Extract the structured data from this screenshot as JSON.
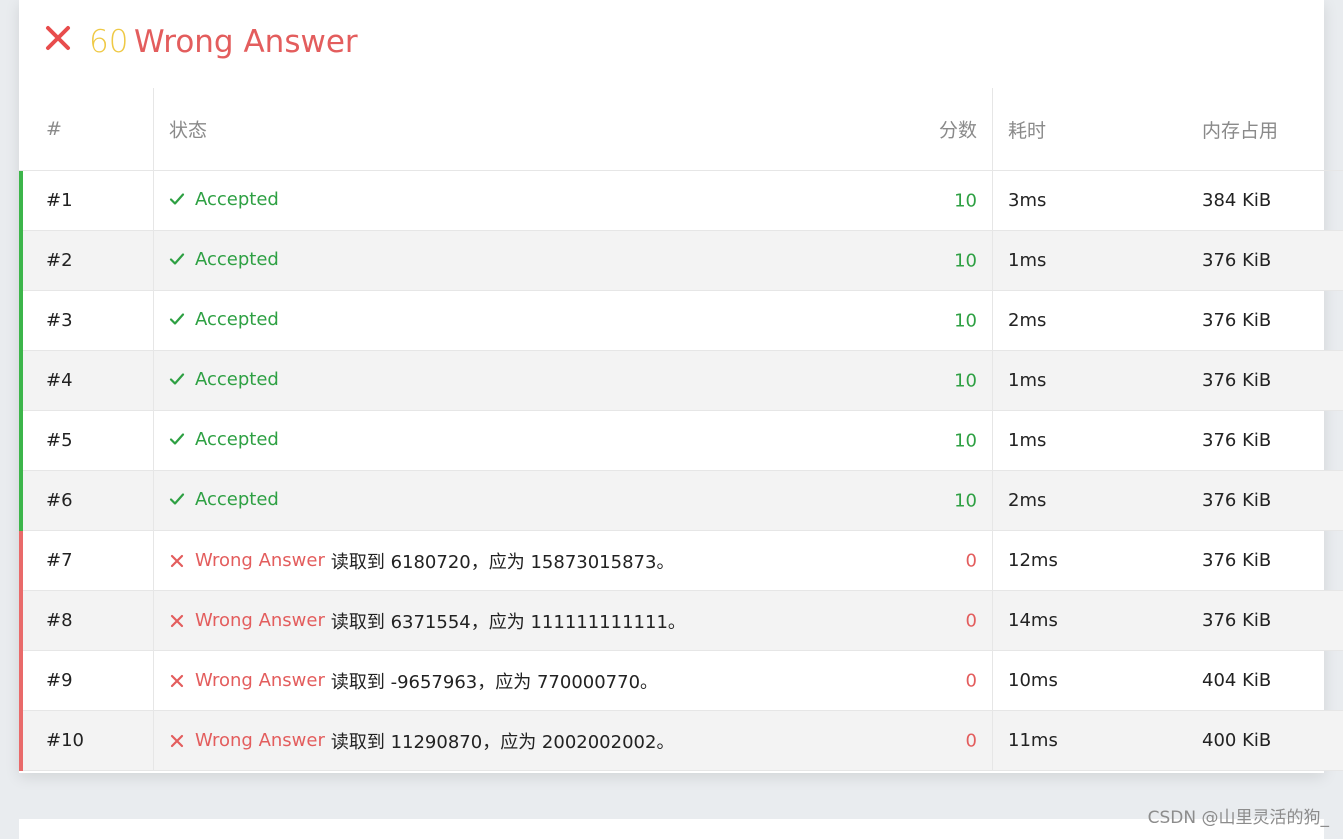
{
  "header": {
    "score": "60",
    "status": "Wrong Answer",
    "icon": "close-icon",
    "score_color": "#efc945",
    "status_color": "#e35d5d"
  },
  "table": {
    "columns": {
      "num": "#",
      "status": "状态",
      "score": "分数",
      "time": "耗时",
      "memory": "内存占用"
    },
    "rows": [
      {
        "num": "#1",
        "status": "Accepted",
        "message": "",
        "score": "10",
        "time": "3ms",
        "memory": "384 KiB",
        "ok": true
      },
      {
        "num": "#2",
        "status": "Accepted",
        "message": "",
        "score": "10",
        "time": "1ms",
        "memory": "376 KiB",
        "ok": true
      },
      {
        "num": "#3",
        "status": "Accepted",
        "message": "",
        "score": "10",
        "time": "2ms",
        "memory": "376 KiB",
        "ok": true
      },
      {
        "num": "#4",
        "status": "Accepted",
        "message": "",
        "score": "10",
        "time": "1ms",
        "memory": "376 KiB",
        "ok": true
      },
      {
        "num": "#5",
        "status": "Accepted",
        "message": "",
        "score": "10",
        "time": "1ms",
        "memory": "376 KiB",
        "ok": true
      },
      {
        "num": "#6",
        "status": "Accepted",
        "message": "",
        "score": "10",
        "time": "2ms",
        "memory": "376 KiB",
        "ok": true
      },
      {
        "num": "#7",
        "status": "Wrong Answer",
        "message": "读取到 6180720，应为 15873015873。",
        "score": "0",
        "time": "12ms",
        "memory": "376 KiB",
        "ok": false
      },
      {
        "num": "#8",
        "status": "Wrong Answer",
        "message": "读取到 6371554，应为 111111111111。",
        "score": "0",
        "time": "14ms",
        "memory": "376 KiB",
        "ok": false
      },
      {
        "num": "#9",
        "status": "Wrong Answer",
        "message": "读取到 -9657963，应为 770000770。",
        "score": "0",
        "time": "10ms",
        "memory": "404 KiB",
        "ok": false
      },
      {
        "num": "#10",
        "status": "Wrong Answer",
        "message": "读取到 11290870，应为 2002002002。",
        "score": "0",
        "time": "11ms",
        "memory": "400 KiB",
        "ok": false
      }
    ]
  },
  "colors": {
    "accepted": "#2ea043",
    "wrong": "#e35d5d",
    "accepted_bar": "#3cb54a",
    "wrong_bar": "#e96a6a"
  },
  "watermark": "CSDN @山里灵活的狗_"
}
